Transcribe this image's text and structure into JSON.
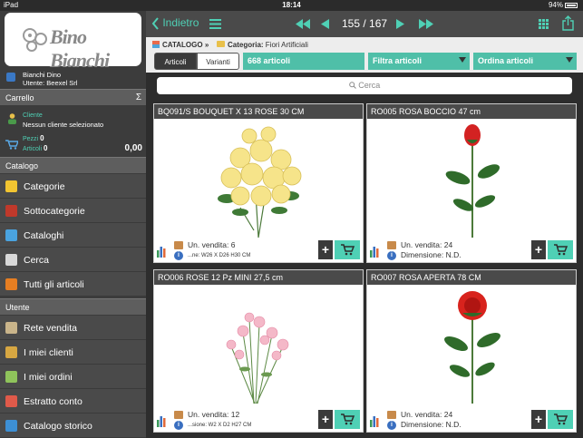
{
  "status_bar": {
    "device": "iPad",
    "time": "18:14",
    "battery": "94%"
  },
  "sidebar": {
    "logo_text": "Bino Bianchi",
    "user_name": "Bianchi Dino",
    "user_account": "Utente: Beexel Srl",
    "cart_section": "Carrello",
    "cart_sigma": "Σ",
    "client_label": "Cliente",
    "client_value": "Nessun cliente selezionato",
    "pieces_label": "Pezzi",
    "pieces_value": "0",
    "articles_label": "Articoli",
    "articles_value": "0",
    "total": "0,00",
    "catalog_section": "Catalogo",
    "catalog_items": [
      {
        "label": "Categorie",
        "icon": "categories-icon",
        "color": "#f2c531"
      },
      {
        "label": "Sottocategorie",
        "icon": "subcategories-icon",
        "color": "#c0392b"
      },
      {
        "label": "Cataloghi",
        "icon": "catalogs-icon",
        "color": "#4aa3df"
      },
      {
        "label": "Cerca",
        "icon": "search-icon",
        "color": "#d8d8d8"
      },
      {
        "label": "Tutti gli articoli",
        "icon": "all-articles-icon",
        "color": "#e67e22"
      }
    ],
    "user_section": "Utente",
    "user_items": [
      {
        "label": "Rete vendita",
        "icon": "sales-network-icon",
        "color": "#c9b48a"
      },
      {
        "label": "I miei clienti",
        "icon": "my-clients-icon",
        "color": "#d7a742"
      },
      {
        "label": "I miei ordini",
        "icon": "my-orders-icon",
        "color": "#8fc35b"
      },
      {
        "label": "Estratto conto",
        "icon": "statement-icon",
        "color": "#e05a4a"
      },
      {
        "label": "Catalogo storico",
        "icon": "history-catalog-icon",
        "color": "#3d8fd4"
      }
    ]
  },
  "topbar": {
    "back_label": "Indietro",
    "page_current": "155",
    "page_total": "167"
  },
  "breadcrumb": {
    "root": "CATALOGO",
    "sep": "»",
    "category_label": "Categoria:",
    "category_value": "Fiori Artificiali"
  },
  "filters": {
    "segment_articoli": "Articoli",
    "segment_varianti": "Varianti",
    "count": "668 articoli",
    "filter_label": "Filtra articoli",
    "order_label": "Ordina articoli"
  },
  "search": {
    "placeholder": "Cerca"
  },
  "colors": {
    "accent": "#4fd0b5",
    "dark": "#2d2d2d"
  },
  "products": [
    {
      "title": "BQ091/S BOUQUET X 13 ROSE 30 CM",
      "unit": "Un. vendita: 6",
      "dimension": "...ne: W26 X D26 H30 CM"
    },
    {
      "title": "RO005 ROSA BOCCIO 47 cm",
      "unit": "Un. vendita: 24",
      "dimension": "Dimensione: N.D."
    },
    {
      "title": "RO006 ROSE 12 Pz MINI 27,5 cm",
      "unit": "Un. vendita: 12",
      "dimension": "...sione: W2 X D2 H27 CM"
    },
    {
      "title": "RO007 ROSA APERTA 78 CM",
      "unit": "Un. vendita: 24",
      "dimension": "Dimensione: N.D."
    }
  ]
}
